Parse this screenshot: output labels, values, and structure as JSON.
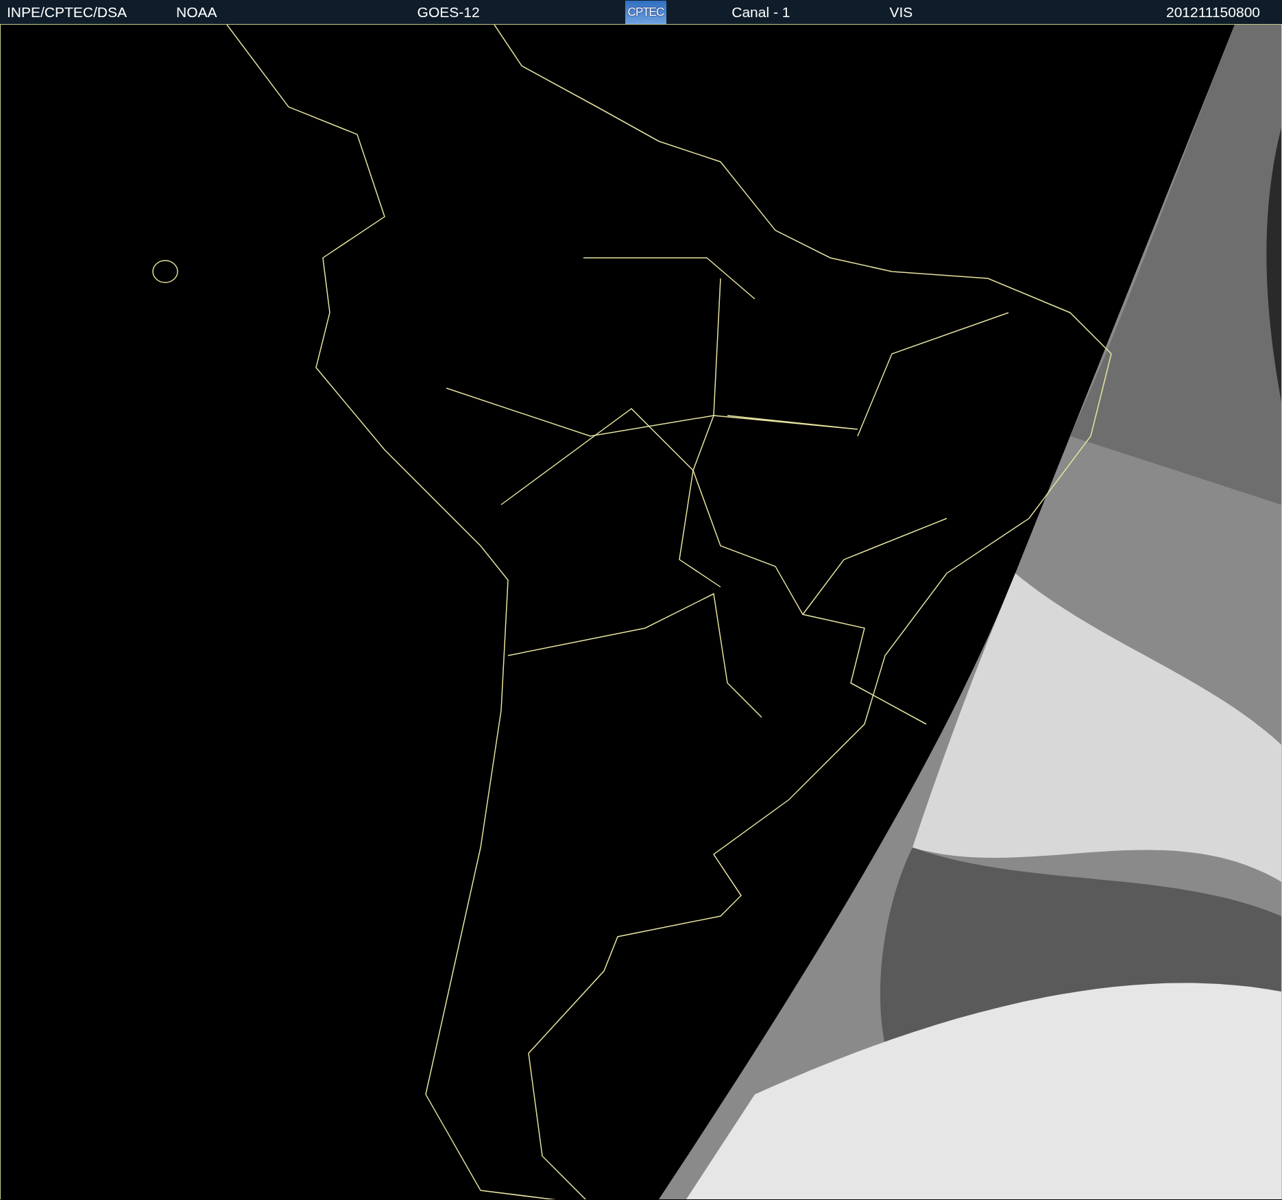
{
  "header": {
    "items": [
      {
        "kind": "text",
        "text": "INPE/CPTEC/DSA"
      },
      {
        "kind": "text",
        "text": "NOAA"
      },
      {
        "kind": "text",
        "text": "GOES-12"
      },
      {
        "kind": "logo",
        "text": "CPTEC"
      },
      {
        "kind": "text",
        "text": "Canal - 1"
      },
      {
        "kind": "text",
        "text": "VIS"
      },
      {
        "kind": "text",
        "text": "201211150800"
      }
    ]
  }
}
